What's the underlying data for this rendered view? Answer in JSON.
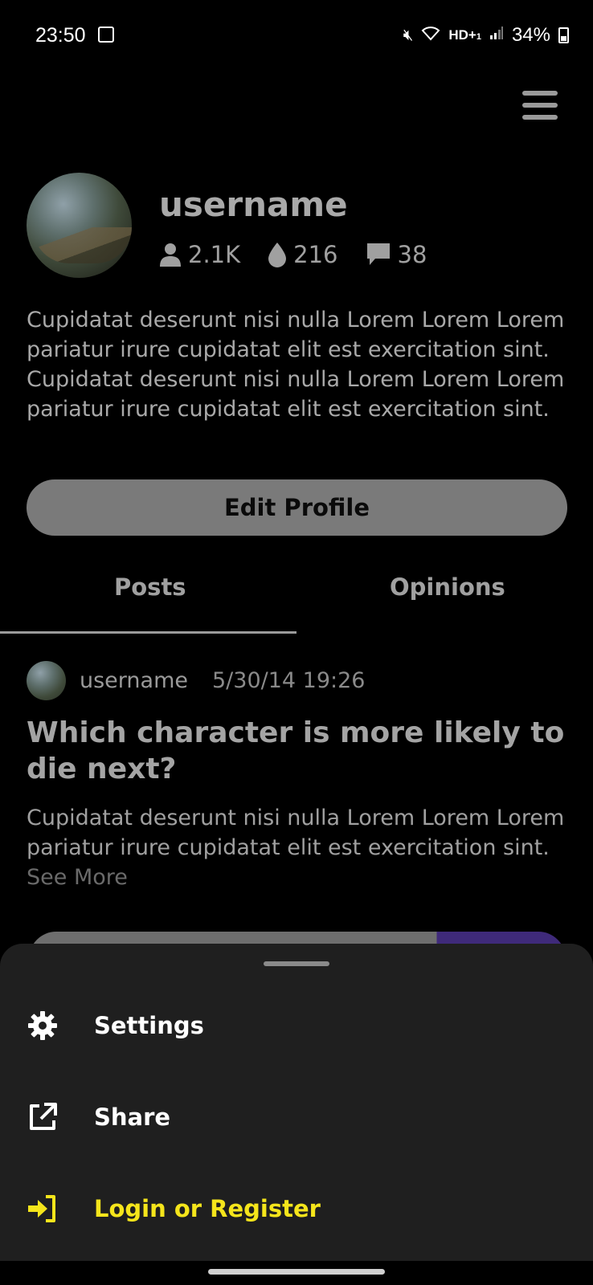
{
  "status_bar": {
    "time": "23:50",
    "battery": "34%",
    "net": "HD+",
    "net_sub": "1"
  },
  "profile": {
    "username": "username",
    "stats": {
      "followers": "2.1K",
      "drops": "216",
      "comments": "38"
    },
    "bio": "Cupidatat deserunt nisi nulla Lorem Lorem Lorem pariatur irure cupidatat elit est exercitation sint. Cupidatat deserunt nisi nulla Lorem Lorem Lorem pariatur irure cupidatat elit est exercitation sint.",
    "edit_label": "Edit Profile"
  },
  "tabs": [
    {
      "label": "Posts"
    },
    {
      "label": "Opinions"
    }
  ],
  "post": {
    "username": "username",
    "date": "5/30/14 19:26",
    "title": "Which character is more likely to die next?",
    "body": "Cupidatat deserunt nisi nulla Lorem Lorem Lorem pariatur irure cupidatat elit est exercitation sint.",
    "see_more": "See More"
  },
  "sheet": {
    "items": [
      {
        "label": "Settings",
        "icon": "gear-icon"
      },
      {
        "label": "Share",
        "icon": "external-link-icon"
      },
      {
        "label": "Login or Register",
        "icon": "login-icon",
        "color": "#f5e51b"
      }
    ]
  },
  "colors": {
    "background": "#000000",
    "sheet": "#1f1f1f",
    "accent_login": "#f5e51b",
    "poll_accent": "#3f2a7a"
  }
}
